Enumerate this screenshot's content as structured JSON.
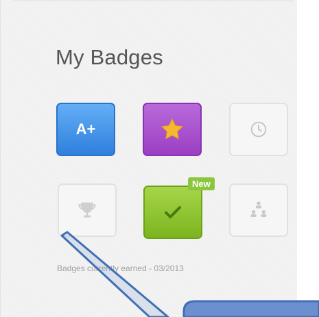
{
  "section": {
    "title": "My Badges"
  },
  "badges": [
    {
      "label": "A+",
      "icon": "a-plus-icon",
      "color": "#3a8fe6",
      "earned": true
    },
    {
      "icon": "star-icon",
      "color": "#a44fcf",
      "earned": true
    },
    {
      "icon": "clock-icon",
      "earned": false
    },
    {
      "icon": "trophy-icon",
      "earned": false
    },
    {
      "icon": "checkmark-icon",
      "color": "#8cc63f",
      "earned": true,
      "tag": "New"
    },
    {
      "icon": "org-chart-icon",
      "earned": false
    }
  ],
  "footer": {
    "caption": "Badges currently earned - 03/2013"
  },
  "annotation": {
    "color": "#3f6fb5",
    "fill": "#6b8fcf"
  }
}
